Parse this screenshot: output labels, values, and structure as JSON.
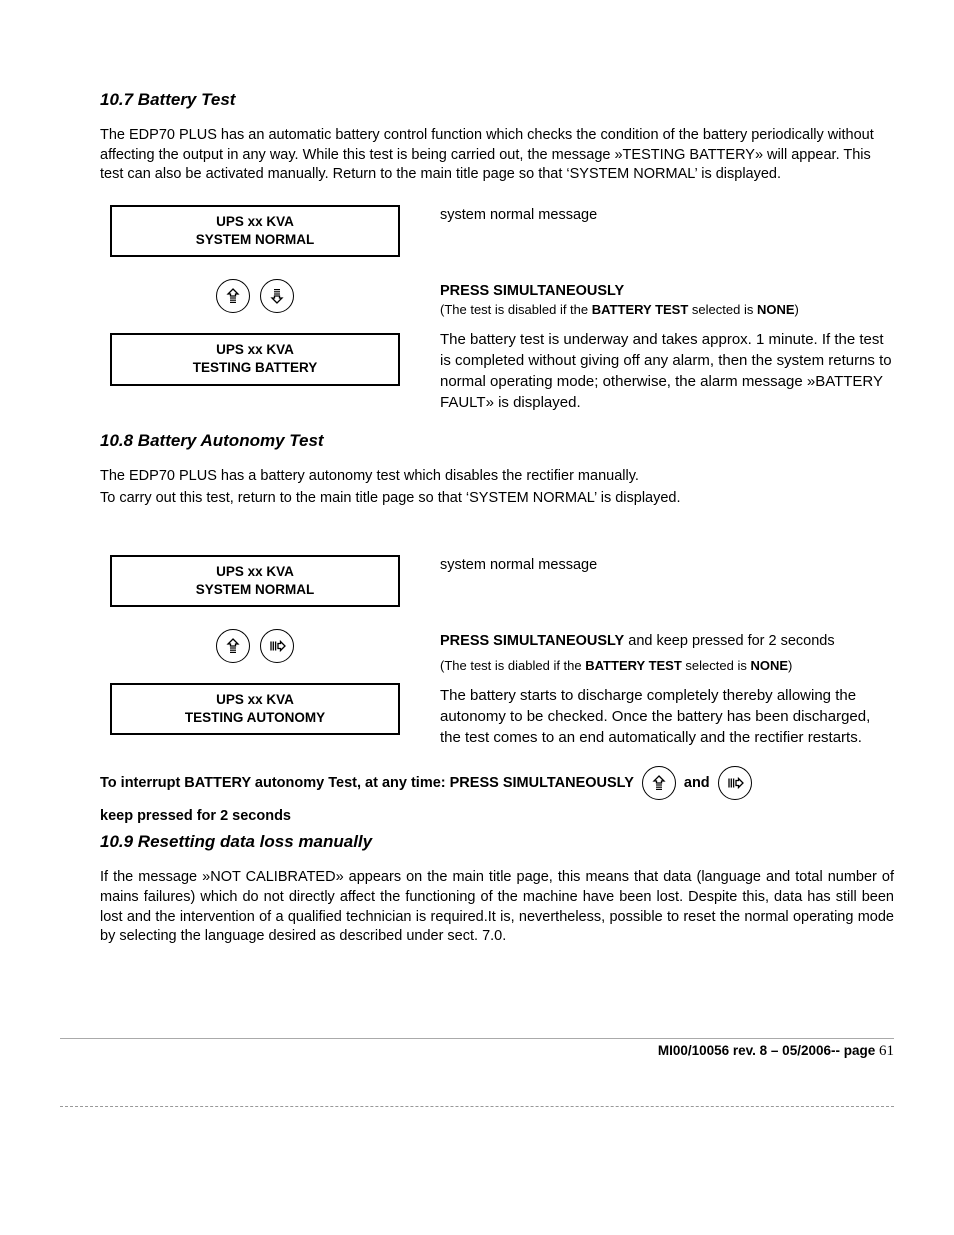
{
  "sections": {
    "s107": {
      "heading": "10.7   Battery Test",
      "intro": "The EDP70 PLUS has an automatic battery control function which checks the condition of the battery periodically without affecting the output in any way. While this test is being carried out, the message »TESTING BATTERY» will appear. This test can also be activated manually. Return to the main title page so that ‘SYSTEM NORMAL’ is displayed.",
      "lcd1_line1": "UPS xx KVA",
      "lcd1_line2": "SYSTEM NORMAL",
      "lcd2_line1": "UPS xx KVA",
      "lcd2_line2": "TESTING BATTERY",
      "right_top": "system normal message",
      "press_label": "PRESS SIMULTANEOUSLY",
      "press_note_pre": "(The test is disabled if the ",
      "press_note_b1": "BATTERY TEST",
      "press_note_mid": " selected is ",
      "press_note_b2": "NONE",
      "press_note_post": ")",
      "body": "The battery test is underway and takes approx. 1 minute. If the test is completed without giving off any alarm, then the system returns to normal operating mode; otherwise, the alarm message »BATTERY FAULT» is displayed."
    },
    "s108": {
      "heading": "10.8   Battery Autonomy Test",
      "intro1": "The EDP70 PLUS has a battery autonomy test which disables the rectifier manually.",
      "intro2": "To carry out this test, return to the main title page so that ‘SYSTEM NORMAL’ is displayed.",
      "lcd1_line1": "UPS xx KVA",
      "lcd1_line2": "SYSTEM NORMAL",
      "lcd2_line1": "UPS xx KVA",
      "lcd2_line2": "TESTING AUTONOMY",
      "right_top": "system normal message",
      "press_label_b": "PRESS SIMULTANEOUSLY",
      "press_label_tail": " and keep pressed for 2 seconds",
      "press_note_pre": "(The test is diabled if the ",
      "press_note_b1": "BATTERY TEST",
      "press_note_mid": " selected is ",
      "press_note_b2": "NONE",
      "press_note_post": ")",
      "body": "The battery starts to discharge completely thereby allowing the autonomy to be checked. Once the battery has been discharged, the test comes to an end automatically and the rectifier restarts.",
      "interrupt_pre": "To interrupt BATTERY autonomy Test, at any time: PRESS SIMULTANEOUSLY",
      "interrupt_mid": "and",
      "interrupt_post": "keep pressed for 2 seconds"
    },
    "s109": {
      "heading": "10.9   Resetting data loss manually",
      "body": "If the message »NOT CALIBRATED» appears on the main title page, this means that data (language and total number of mains failures) which do not directly affect the functioning of the machine have been lost. Despite this, data has still been lost and the intervention of a qualified technician is required.It is, nevertheless, possible to reset the normal operating mode by selecting the language desired as described under sect. 7.0."
    }
  },
  "footer": {
    "ref": "MI00/10056 rev. 8 – 05/2006-- page ",
    "page": "61"
  }
}
